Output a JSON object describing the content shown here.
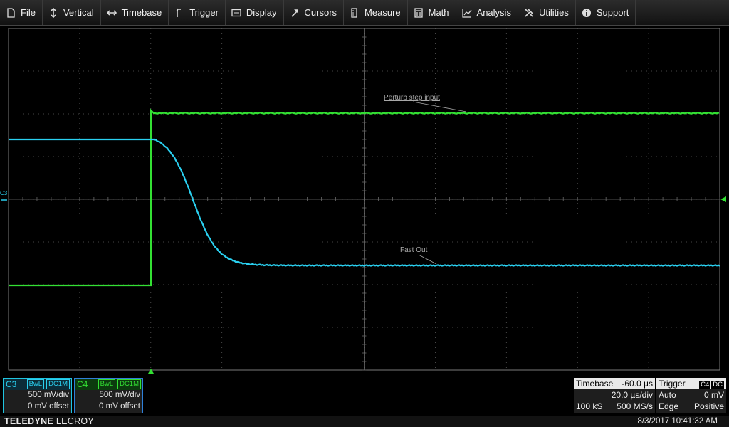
{
  "menu": [
    {
      "label": "File",
      "icon": "file-icon"
    },
    {
      "label": "Vertical",
      "icon": "vertical-arrows-icon"
    },
    {
      "label": "Timebase",
      "icon": "horizontal-arrows-icon"
    },
    {
      "label": "Trigger",
      "icon": "trigger-icon"
    },
    {
      "label": "Display",
      "icon": "display-icon"
    },
    {
      "label": "Cursors",
      "icon": "cursor-icon"
    },
    {
      "label": "Measure",
      "icon": "measure-icon"
    },
    {
      "label": "Math",
      "icon": "math-icon"
    },
    {
      "label": "Analysis",
      "icon": "analysis-icon"
    },
    {
      "label": "Utilities",
      "icon": "utilities-icon"
    },
    {
      "label": "Support",
      "icon": "support-icon"
    }
  ],
  "colors": {
    "c3": "#2ad0f0",
    "c4": "#33e033",
    "grid": "#5a5a5a",
    "background": "#000000"
  },
  "scope": {
    "channel_marker": "C3",
    "trace_labels": {
      "c4": "Perturb step input",
      "c3": "Fast Out"
    }
  },
  "channels": {
    "c3": {
      "name": "C3",
      "bw": "BwL",
      "coupling": "DC1M",
      "scale": "500 mV/div",
      "offset": "0 mV offset"
    },
    "c4": {
      "name": "C4",
      "bw": "BwL",
      "coupling": "DC1M",
      "scale": "500 mV/div",
      "offset": "0 mV offset"
    }
  },
  "timebase": {
    "title": "Timebase",
    "delay": "-60.0 µs",
    "scale": "20.0 µs/div",
    "samples": "100 kS",
    "rate": "500 MS/s"
  },
  "trigger": {
    "title": "Trigger",
    "source": "C4",
    "coupling": "DC",
    "mode": "Auto",
    "level": "0 mV",
    "type": "Edge",
    "slope": "Positive"
  },
  "footer": {
    "brand_bold": "TELEDYNE",
    "brand_rest": " LECROY",
    "datetime": "8/3/2017 10:41:32 AM"
  }
}
